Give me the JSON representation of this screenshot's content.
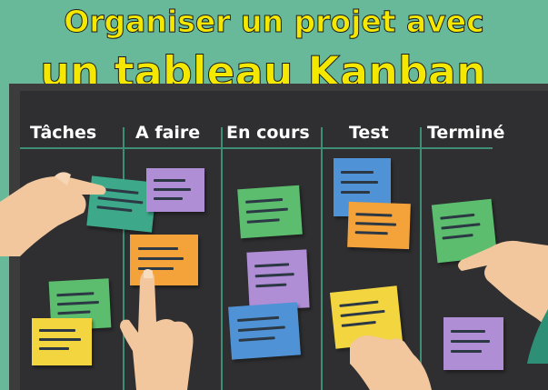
{
  "title": {
    "line1": "Organiser un projet avec",
    "line2": "un tableau Kanban"
  },
  "columns": [
    "Tâches",
    "A faire",
    "En cours",
    "Test",
    "Terminé"
  ],
  "colors": {
    "background": "#67b99a",
    "board": "#2f2f31",
    "title_text": "#f4e800",
    "column_divider": "#3d8e74",
    "note_green": "#5cbd6f",
    "note_purple": "#b08ed6",
    "note_orange": "#f4a23a",
    "note_yellow": "#f2d53f",
    "note_blue": "#4f93d6",
    "skin": "#f2c79e"
  }
}
